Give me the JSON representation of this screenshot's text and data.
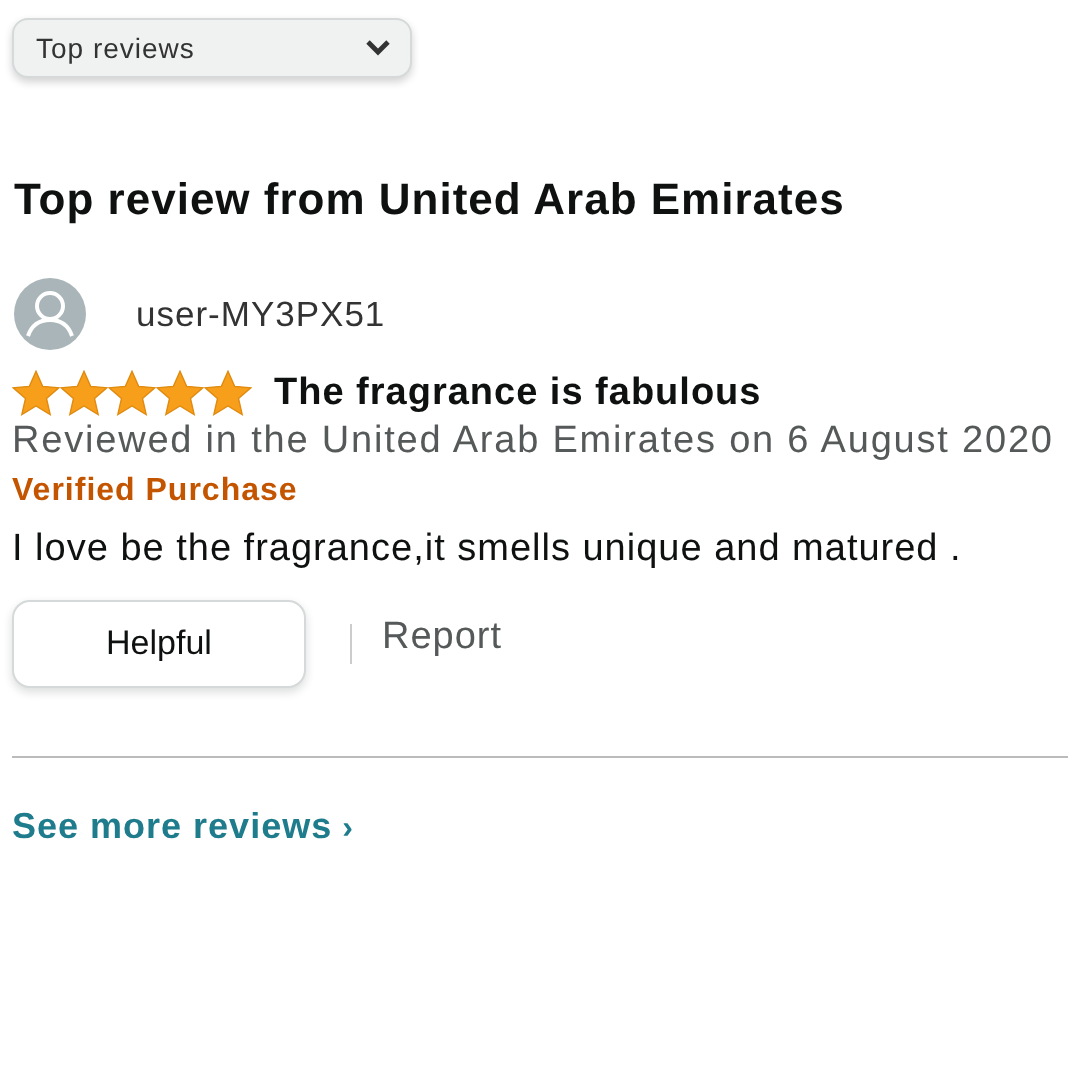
{
  "sort_dropdown": {
    "value": "Top reviews"
  },
  "heading": "Top review from United Arab Emirates",
  "review": {
    "author": "user-MY3PX51",
    "stars": 5,
    "title": "The fragrance is fabulous",
    "date_line": "Reviewed in the United Arab Emirates on 6 August 2020",
    "verified": true,
    "verified_label": "Verified Purchase",
    "body": "I love be the fragrance,it smells unique and matured .",
    "helpful_button": "Helpful",
    "report_link": "Report"
  },
  "see_more": {
    "label": "See more reviews",
    "arrow": "›"
  }
}
